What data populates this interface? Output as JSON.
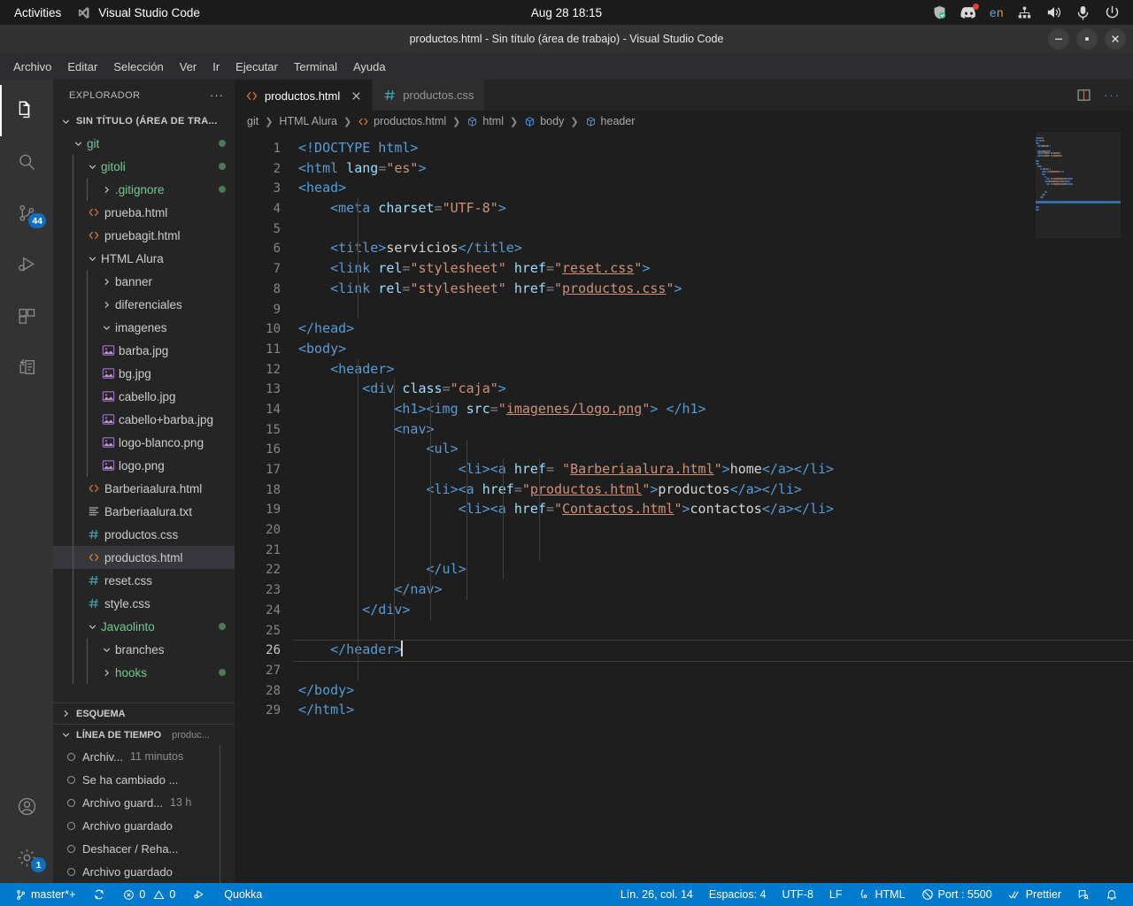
{
  "desktop": {
    "activities_label": "Activities",
    "app_name": "Visual Studio Code",
    "clock": "Aug 28  18:15",
    "tray": {
      "shield_icon": "shield-check-icon",
      "discord_icon": "discord-icon",
      "language": {
        "first": "e",
        "second": "n"
      },
      "network_icon": "network-icon",
      "volume_icon": "volume-icon",
      "microphone_icon": "microphone-icon",
      "power_icon": "power-icon"
    }
  },
  "window": {
    "title": "productos.html - Sin título (área de trabajo) - Visual Studio Code",
    "minimize_label": "—",
    "maximize_label": "▪",
    "close_label": "✕"
  },
  "menubar": [
    "Archivo",
    "Editar",
    "Selección",
    "Ver",
    "Ir",
    "Ejecutar",
    "Terminal",
    "Ayuda"
  ],
  "activitybar": {
    "items": [
      {
        "name": "explorer",
        "icon": "files-icon",
        "active": true,
        "badge": ""
      },
      {
        "name": "search",
        "icon": "search-icon",
        "active": false,
        "badge": ""
      },
      {
        "name": "source-control",
        "icon": "source-control-icon",
        "active": false,
        "badge": "44"
      },
      {
        "name": "run-and-debug",
        "icon": "run-debug-icon",
        "active": false,
        "badge": ""
      },
      {
        "name": "extensions",
        "icon": "extensions-icon",
        "active": false,
        "badge": ""
      },
      {
        "name": "remote-explorer",
        "icon": "remote-explorer-icon",
        "active": false,
        "badge": ""
      }
    ],
    "bottom": [
      {
        "name": "accounts",
        "icon": "account-icon",
        "badge": ""
      },
      {
        "name": "manage",
        "icon": "gear-icon",
        "badge": "1"
      }
    ]
  },
  "sidebar": {
    "title": "EXPLORADOR",
    "more_actions": "···",
    "workspace": "SIN TÍTULO (ÁREA DE TRA...",
    "tree": [
      {
        "label": "git",
        "indent": 1,
        "type": "folder",
        "expanded": true,
        "color": "green",
        "dot": true
      },
      {
        "label": "gitoli",
        "indent": 2,
        "type": "folder",
        "expanded": true,
        "color": "green",
        "dot": true
      },
      {
        "label": ".gitignore",
        "indent": 3,
        "type": "folder",
        "expanded": false,
        "color": "green",
        "dot": true
      },
      {
        "label": "prueba.html",
        "indent": 2,
        "type": "html",
        "color": "default"
      },
      {
        "label": "pruebagit.html",
        "indent": 2,
        "type": "html",
        "color": "default"
      },
      {
        "label": "HTML Alura",
        "indent": 2,
        "type": "folder",
        "expanded": true,
        "color": "default"
      },
      {
        "label": "banner",
        "indent": 3,
        "type": "folder",
        "expanded": false,
        "color": "default"
      },
      {
        "label": "diferenciales",
        "indent": 3,
        "type": "folder",
        "expanded": false,
        "color": "default"
      },
      {
        "label": "imagenes",
        "indent": 3,
        "type": "folder",
        "expanded": true,
        "color": "default"
      },
      {
        "label": "barba.jpg",
        "indent": 3,
        "type": "image",
        "color": "default"
      },
      {
        "label": "bg.jpg",
        "indent": 3,
        "type": "image",
        "color": "default"
      },
      {
        "label": "cabello.jpg",
        "indent": 3,
        "type": "image",
        "color": "default"
      },
      {
        "label": "cabello+barba.jpg",
        "indent": 3,
        "type": "image",
        "color": "default"
      },
      {
        "label": "logo-blanco.png",
        "indent": 3,
        "type": "image",
        "color": "default"
      },
      {
        "label": "logo.png",
        "indent": 3,
        "type": "image",
        "color": "default"
      },
      {
        "label": "Barberiaalura.html",
        "indent": 2,
        "type": "html",
        "color": "default"
      },
      {
        "label": "Barberiaalura.txt",
        "indent": 2,
        "type": "text",
        "color": "default"
      },
      {
        "label": "productos.css",
        "indent": 2,
        "type": "css",
        "color": "default"
      },
      {
        "label": "productos.html",
        "indent": 2,
        "type": "html",
        "color": "default",
        "selected": true
      },
      {
        "label": "reset.css",
        "indent": 2,
        "type": "css",
        "color": "default"
      },
      {
        "label": "style.css",
        "indent": 2,
        "type": "css",
        "color": "default"
      },
      {
        "label": "Javaolinto",
        "indent": 2,
        "type": "folder",
        "expanded": true,
        "color": "green",
        "dot": true
      },
      {
        "label": "branches",
        "indent": 3,
        "type": "folder",
        "expanded": true,
        "color": "default"
      },
      {
        "label": "hooks",
        "indent": 3,
        "type": "folder",
        "expanded": false,
        "color": "green",
        "dot": true
      }
    ],
    "outline_title": "ESQUEMA",
    "timeline_title": "LÍNEA DE TIEMPO",
    "timeline_subtitle": "produc...",
    "timeline": [
      {
        "label": "Archiv...",
        "time": "11 minutos"
      },
      {
        "label": "Se ha cambiado ...",
        "time": ""
      },
      {
        "label": "Archivo guard...",
        "time": "13 h"
      },
      {
        "label": "Archivo guardado",
        "time": ""
      },
      {
        "label": "Deshacer / Reha...",
        "time": ""
      },
      {
        "label": "Archivo guardado",
        "time": ""
      }
    ]
  },
  "tabs": [
    {
      "label": "productos.html",
      "icon": "html-icon",
      "active": true,
      "closable": true
    },
    {
      "label": "productos.css",
      "icon": "css-icon",
      "active": false,
      "closable": false
    }
  ],
  "tab_actions": {
    "split_editor": "split-editor-icon",
    "more": "···"
  },
  "breadcrumb": [
    {
      "label": "git",
      "icon": ""
    },
    {
      "label": "HTML Alura",
      "icon": ""
    },
    {
      "label": "productos.html",
      "icon": "html-icon"
    },
    {
      "label": "html",
      "icon": "symbol-icon"
    },
    {
      "label": "body",
      "icon": "symbol-icon"
    },
    {
      "label": "header",
      "icon": "symbol-icon"
    }
  ],
  "editor": {
    "cursor_line": 26,
    "total_lines": 29,
    "lines": [
      {
        "n": 1,
        "tokens": [
          {
            "t": "<!DOCTYPE",
            "c": "dt"
          },
          {
            "t": " html>",
            "c": "tag"
          }
        ]
      },
      {
        "n": 2,
        "tokens": [
          {
            "t": "<html",
            "c": "tag"
          },
          {
            "t": " lang",
            "c": "attr"
          },
          {
            "t": "=",
            "c": "punc"
          },
          {
            "t": "\"es\"",
            "c": "str"
          },
          {
            "t": ">",
            "c": "tag"
          }
        ]
      },
      {
        "n": 3,
        "tokens": [
          {
            "t": "<head>",
            "c": "tag"
          }
        ]
      },
      {
        "n": 4,
        "tokens": [
          {
            "t": "    <meta",
            "c": "tag"
          },
          {
            "t": " charset",
            "c": "attr"
          },
          {
            "t": "=",
            "c": "punc"
          },
          {
            "t": "\"UTF-8\"",
            "c": "str"
          },
          {
            "t": ">",
            "c": "tag"
          }
        ]
      },
      {
        "n": 5,
        "tokens": []
      },
      {
        "n": 6,
        "tokens": [
          {
            "t": "    <title>",
            "c": "tag"
          },
          {
            "t": "servicios",
            "c": "txt"
          },
          {
            "t": "</title>",
            "c": "tag"
          }
        ]
      },
      {
        "n": 7,
        "tokens": [
          {
            "t": "    <link",
            "c": "tag"
          },
          {
            "t": " rel",
            "c": "attr"
          },
          {
            "t": "=",
            "c": "punc"
          },
          {
            "t": "\"stylesheet\"",
            "c": "str"
          },
          {
            "t": " href",
            "c": "attr"
          },
          {
            "t": "=",
            "c": "punc"
          },
          {
            "t": "\"",
            "c": "str"
          },
          {
            "t": "reset.css",
            "c": "strlink"
          },
          {
            "t": "\"",
            "c": "str"
          },
          {
            "t": ">",
            "c": "tag"
          }
        ]
      },
      {
        "n": 8,
        "tokens": [
          {
            "t": "    <link",
            "c": "tag"
          },
          {
            "t": " rel",
            "c": "attr"
          },
          {
            "t": "=",
            "c": "punc"
          },
          {
            "t": "\"stylesheet\"",
            "c": "str"
          },
          {
            "t": " href",
            "c": "attr"
          },
          {
            "t": "=",
            "c": "punc"
          },
          {
            "t": "\"",
            "c": "str"
          },
          {
            "t": "productos.css",
            "c": "strlink"
          },
          {
            "t": "\"",
            "c": "str"
          },
          {
            "t": ">",
            "c": "tag"
          }
        ]
      },
      {
        "n": 9,
        "tokens": []
      },
      {
        "n": 10,
        "tokens": [
          {
            "t": "</head>",
            "c": "tag"
          }
        ]
      },
      {
        "n": 11,
        "tokens": [
          {
            "t": "<body>",
            "c": "tag"
          }
        ]
      },
      {
        "n": 12,
        "tokens": [
          {
            "t": "    <header>",
            "c": "tag"
          }
        ]
      },
      {
        "n": 13,
        "tokens": [
          {
            "t": "        <div",
            "c": "tag"
          },
          {
            "t": " class",
            "c": "attr"
          },
          {
            "t": "=",
            "c": "punc"
          },
          {
            "t": "\"caja\"",
            "c": "str"
          },
          {
            "t": ">",
            "c": "tag"
          }
        ]
      },
      {
        "n": 14,
        "tokens": [
          {
            "t": "            <h1><img",
            "c": "tag"
          },
          {
            "t": " src",
            "c": "attr"
          },
          {
            "t": "=",
            "c": "punc"
          },
          {
            "t": "\"",
            "c": "str"
          },
          {
            "t": "imagenes/logo.png",
            "c": "strlink"
          },
          {
            "t": "\"",
            "c": "str"
          },
          {
            "t": ">",
            "c": "tag"
          },
          {
            "t": " ",
            "c": "txt"
          },
          {
            "t": "</h1>",
            "c": "tag"
          }
        ]
      },
      {
        "n": 15,
        "tokens": [
          {
            "t": "            <nav>",
            "c": "tag"
          }
        ]
      },
      {
        "n": 16,
        "tokens": [
          {
            "t": "                <ul>",
            "c": "tag"
          }
        ]
      },
      {
        "n": 17,
        "tokens": [
          {
            "t": "                    <li><a",
            "c": "tag"
          },
          {
            "t": " href",
            "c": "attr"
          },
          {
            "t": "=",
            "c": "punc"
          },
          {
            "t": " ",
            "c": "txt"
          },
          {
            "t": "\"",
            "c": "str"
          },
          {
            "t": "Barberiaalura.html",
            "c": "strlink"
          },
          {
            "t": "\"",
            "c": "str"
          },
          {
            "t": ">",
            "c": "tag"
          },
          {
            "t": "home",
            "c": "txt"
          },
          {
            "t": "</a></li>",
            "c": "tag"
          }
        ]
      },
      {
        "n": 18,
        "tokens": [
          {
            "t": "                <li><a",
            "c": "tag"
          },
          {
            "t": " href",
            "c": "attr"
          },
          {
            "t": "=",
            "c": "punc"
          },
          {
            "t": "\"",
            "c": "str"
          },
          {
            "t": "productos.html",
            "c": "strlink"
          },
          {
            "t": "\"",
            "c": "str"
          },
          {
            "t": ">",
            "c": "tag"
          },
          {
            "t": "productos",
            "c": "txt"
          },
          {
            "t": "</a></li>",
            "c": "tag"
          }
        ]
      },
      {
        "n": 19,
        "tokens": [
          {
            "t": "                    <li><a",
            "c": "tag"
          },
          {
            "t": " href",
            "c": "attr"
          },
          {
            "t": "=",
            "c": "punc"
          },
          {
            "t": "\"",
            "c": "str"
          },
          {
            "t": "Contactos.html",
            "c": "strlink"
          },
          {
            "t": "\"",
            "c": "str"
          },
          {
            "t": ">",
            "c": "tag"
          },
          {
            "t": "contactos",
            "c": "txt"
          },
          {
            "t": "</a></li>",
            "c": "tag"
          }
        ]
      },
      {
        "n": 20,
        "tokens": []
      },
      {
        "n": 21,
        "tokens": []
      },
      {
        "n": 22,
        "tokens": [
          {
            "t": "                </ul>",
            "c": "tag"
          }
        ]
      },
      {
        "n": 23,
        "tokens": [
          {
            "t": "            </nav>",
            "c": "tag"
          }
        ]
      },
      {
        "n": 24,
        "tokens": [
          {
            "t": "        </div>",
            "c": "tag"
          }
        ]
      },
      {
        "n": 25,
        "tokens": []
      },
      {
        "n": 26,
        "tokens": [
          {
            "t": "    </header>",
            "c": "tag"
          }
        ],
        "active": true,
        "cursor": true
      },
      {
        "n": 27,
        "tokens": []
      },
      {
        "n": 28,
        "tokens": [
          {
            "t": "</body>",
            "c": "tag"
          }
        ]
      },
      {
        "n": 29,
        "tokens": [
          {
            "t": "</html>",
            "c": "tag"
          }
        ]
      }
    ]
  },
  "statusbar": {
    "branch": "master*+",
    "sync_icon": "sync-icon",
    "errors": "0",
    "warnings": "0",
    "ports_icon": "ports-icon",
    "quokka": "Quokka",
    "position": "Lín. 26, col. 14",
    "indentation": "Espacios: 4",
    "encoding": "UTF-8",
    "eol": "LF",
    "language": "HTML",
    "port": "Port : 5500",
    "prettier": "Prettier",
    "feedback_icon": "feedback-icon",
    "bell_icon": "bell-icon",
    "accent": "#007acc"
  },
  "colors": {
    "editor_bg": "#1e1e1e",
    "sidebar_bg": "#252526",
    "activitybar_bg": "#333333",
    "titlebar_bg": "#323233",
    "status_bg": "#007acc",
    "tag": "#569cd6",
    "attr": "#9cdcfe",
    "string": "#ce9178",
    "text": "#d4d4d4",
    "folder_green": "#73c991"
  }
}
